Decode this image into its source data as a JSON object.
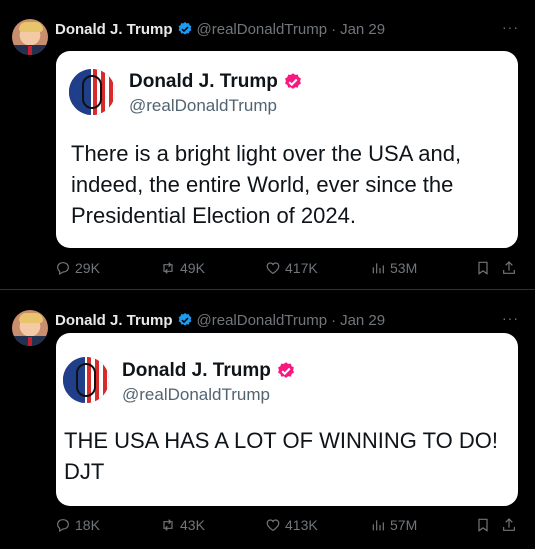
{
  "colors": {
    "background": "#000000",
    "card": "#ffffff",
    "muted": "#71767b",
    "verified": "#1d9bf0",
    "card_verified": "#f91880"
  },
  "posts": [
    {
      "author": {
        "name": "Donald J. Trump",
        "handle": "@realDonaldTrump",
        "date": "Jan 29",
        "separator": "·",
        "avatar_icon": "profile-photo"
      },
      "more_icon": "···",
      "card": {
        "name": "Donald J. Trump",
        "handle": "@realDonaldTrump",
        "text": "There is a bright light over the USA and, indeed, the entire World, ever since the Presidential Election of 2024."
      },
      "metrics": {
        "replies": "29K",
        "reposts": "49K",
        "likes": "417K",
        "views": "53M"
      }
    },
    {
      "author": {
        "name": "Donald J. Trump",
        "handle": "@realDonaldTrump",
        "date": "Jan 29",
        "separator": "·",
        "avatar_icon": "profile-photo"
      },
      "more_icon": "···",
      "card": {
        "name": "Donald J. Trump",
        "handle": "@realDonaldTrump",
        "text": "THE USA HAS A LOT OF WINNING TO DO! DJT"
      },
      "metrics": {
        "replies": "18K",
        "reposts": "43K",
        "likes": "413K",
        "views": "57M"
      }
    }
  ]
}
